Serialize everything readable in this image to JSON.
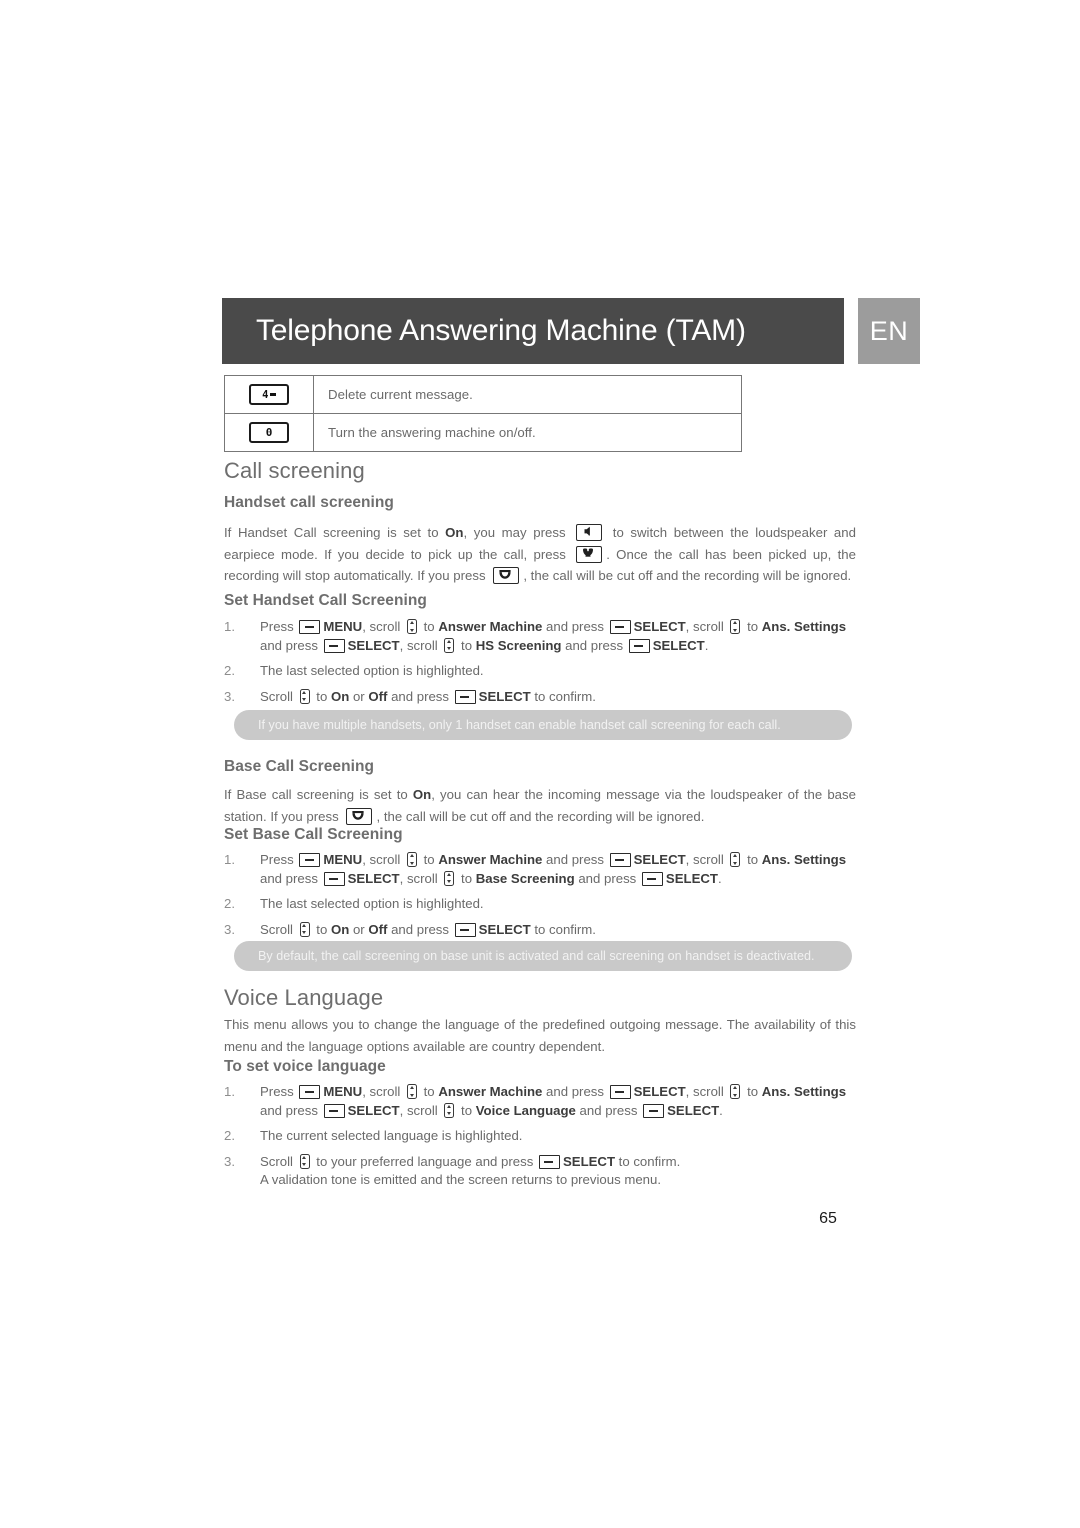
{
  "header": {
    "title": "Telephone Answering Machine (TAM)",
    "language_badge": "EN",
    "bar_color": "#4a4a4a",
    "badge_color": "#9c9c9c"
  },
  "key_table": {
    "rows": [
      {
        "key_label": "4",
        "key_icon": "key-4-delete",
        "description": "Delete current message."
      },
      {
        "key_label": "0",
        "key_icon": "key-0-onoff",
        "description": "Turn the answering machine on/off."
      }
    ]
  },
  "call_screening": {
    "title": "Call screening",
    "handset": {
      "heading": "Handset call screening",
      "paragraph_1": "If Handset Call screening is set to ",
      "bold_on": "On",
      "paragraph_2": ", you may press ",
      "paragraph_3": " to switch between the loudspeaker and earpiece mode. If you decide to pick up the call, press ",
      "paragraph_4": ". Once the call has been picked up, the recording will stop automatically. If you press ",
      "paragraph_5": ", the call will be cut off and the recording will be ignored."
    },
    "set_handset": {
      "heading": "Set Handset Call Screening",
      "steps": [
        {
          "num": "1.",
          "parts": [
            "Press ",
            "MENU",
            ", scroll ",
            " to ",
            "Answer Machine",
            " and press ",
            "SELECT",
            ", scroll ",
            " to ",
            "Ans. Settings",
            " and press ",
            "SELECT",
            ", scroll ",
            " to ",
            "HS Screening",
            " and press ",
            "SELECT",
            "."
          ]
        },
        {
          "num": "2.",
          "text": "The last selected option is highlighted."
        },
        {
          "num": "3.",
          "parts": [
            "Scroll ",
            " to ",
            "On",
            " or ",
            "Off",
            " and press ",
            "SELECT",
            " to confirm."
          ]
        }
      ]
    },
    "tip_handset": "If you have multiple handsets, only 1 handset can enable handset call screening for each call.",
    "base": {
      "heading": "Base Call Screening",
      "paragraph_1": "If Base call screening is set to ",
      "bold_on": "On",
      "paragraph_2": ", you can hear the incoming message via the loudspeaker of the base station. If you press ",
      "paragraph_3": ", the call will be cut off and the recording will be ignored."
    },
    "set_base": {
      "heading": "Set Base Call Screening",
      "steps": [
        {
          "num": "1.",
          "parts": [
            "Press ",
            "MENU",
            ", scroll ",
            " to ",
            "Answer Machine",
            " and press ",
            "SELECT",
            ", scroll ",
            " to ",
            "Ans. Settings",
            " and press ",
            "SELECT",
            ", scroll ",
            " to ",
            "Base Screening",
            " and press ",
            "SELECT",
            "."
          ]
        },
        {
          "num": "2.",
          "text": "The last selected option is highlighted."
        },
        {
          "num": "3.",
          "parts": [
            "Scroll ",
            " to ",
            "On",
            " or ",
            "Off",
            " and press ",
            "SELECT",
            " to confirm."
          ]
        }
      ]
    },
    "tip_base": "By default, the call screening on base unit is activated and call screening on handset is deactivated."
  },
  "voice_language": {
    "title": "Voice Language",
    "intro": "This menu allows you to change the language of the predefined outgoing message. The availability of this menu and the language options available are country dependent.",
    "set_heading": "To set voice language",
    "steps": [
      {
        "num": "1.",
        "parts": [
          "Press ",
          "MENU",
          ", scroll ",
          " to ",
          "Answer Machine",
          " and press ",
          "SELECT",
          ", scroll ",
          " to ",
          "Ans. Settings",
          " and press ",
          "SELECT",
          ", scroll ",
          " to ",
          "Voice Language",
          " and press ",
          "SELECT",
          "."
        ]
      },
      {
        "num": "2.",
        "text": "The current selected language is highlighted."
      },
      {
        "num": "3.",
        "parts": [
          "Scroll ",
          " to your preferred language and press ",
          "SELECT",
          " to confirm."
        ],
        "extra_line": "A validation tone is emitted and the screen returns to previous menu."
      }
    ]
  },
  "footer": {
    "page_number": "65"
  },
  "icons": {
    "softkey": "softkey-icon",
    "scroll": "scroll-updown-icon",
    "speaker": "speaker-icon",
    "pickup": "pickup-call-icon",
    "hangup": "hangup-call-icon"
  }
}
